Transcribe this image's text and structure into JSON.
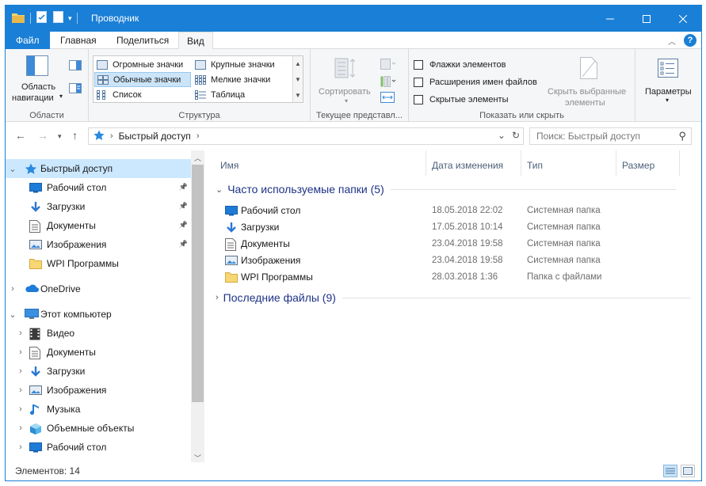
{
  "window": {
    "title": "Проводник"
  },
  "ribbon_tabs": [
    "Файл",
    "Главная",
    "Поделиться",
    "Вид"
  ],
  "ribbon": {
    "nav_pane": {
      "label_line1": "Область",
      "label_line2": "навигации",
      "group": "Области"
    },
    "layouts": {
      "items": [
        "Огромные значки",
        "Крупные значки",
        "Обычные значки",
        "Мелкие значки",
        "Список",
        "Таблица"
      ],
      "selected": "Обычные значки",
      "group": "Структура"
    },
    "current_view": {
      "sort": "Сортировать",
      "group": "Текущее представл..."
    },
    "show_hide": {
      "checkboxes": [
        "Флажки элементов",
        "Расширения имен файлов",
        "Скрытые элементы"
      ],
      "hide_selected_line1": "Скрыть выбранные",
      "hide_selected_line2": "элементы",
      "group": "Показать или скрыть"
    },
    "options": {
      "label": "Параметры"
    }
  },
  "address": {
    "location": "Быстрый доступ"
  },
  "search": {
    "placeholder": "Поиск: Быстрый доступ"
  },
  "nav_tree": [
    {
      "label": "Быстрый доступ",
      "level": 0,
      "icon": "star-icon",
      "expanded": true,
      "selected": true
    },
    {
      "label": "Рабочий стол",
      "level": 1,
      "icon": "desktop-icon",
      "pinned": true
    },
    {
      "label": "Загрузки",
      "level": 1,
      "icon": "download-icon",
      "pinned": true
    },
    {
      "label": "Документы",
      "level": 1,
      "icon": "document-icon",
      "pinned": true
    },
    {
      "label": "Изображения",
      "level": 1,
      "icon": "pictures-icon",
      "pinned": true
    },
    {
      "label": "WPI Программы",
      "level": 1,
      "icon": "folder-icon"
    },
    {
      "label": "OneDrive",
      "level": 0,
      "icon": "cloud-icon"
    },
    {
      "label": "Этот компьютер",
      "level": 0,
      "icon": "computer-icon",
      "expanded": true
    },
    {
      "label": "Видео",
      "level": 1,
      "icon": "video-icon"
    },
    {
      "label": "Документы",
      "level": 1,
      "icon": "document-icon"
    },
    {
      "label": "Загрузки",
      "level": 1,
      "icon": "download-icon"
    },
    {
      "label": "Изображения",
      "level": 1,
      "icon": "pictures-icon"
    },
    {
      "label": "Музыка",
      "level": 1,
      "icon": "music-icon"
    },
    {
      "label": "Объемные объекты",
      "level": 1,
      "icon": "3d-objects-icon"
    },
    {
      "label": "Рабочий стол",
      "level": 1,
      "icon": "desktop-icon"
    }
  ],
  "columns": [
    "Имя",
    "Дата изменения",
    "Тип",
    "Размер"
  ],
  "sections": {
    "frequent": "Часто используемые папки (5)",
    "recent": "Последние файлы (9)"
  },
  "files": [
    {
      "name": "Рабочий стол",
      "date": "18.05.2018 22:02",
      "type": "Системная папка",
      "icon": "desktop-icon"
    },
    {
      "name": "Загрузки",
      "date": "17.05.2018 10:14",
      "type": "Системная папка",
      "icon": "download-icon"
    },
    {
      "name": "Документы",
      "date": "23.04.2018 19:58",
      "type": "Системная папка",
      "icon": "document-icon"
    },
    {
      "name": "Изображения",
      "date": "23.04.2018 19:58",
      "type": "Системная папка",
      "icon": "pictures-icon"
    },
    {
      "name": "WPI Программы",
      "date": "28.03.2018 1:36",
      "type": "Папка с файлами",
      "icon": "folder-icon"
    }
  ],
  "status": {
    "items": "Элементов: 14"
  },
  "colors": {
    "accent": "#1a7fd6",
    "selection": "#cce8ff",
    "section_header": "#1e3287"
  }
}
